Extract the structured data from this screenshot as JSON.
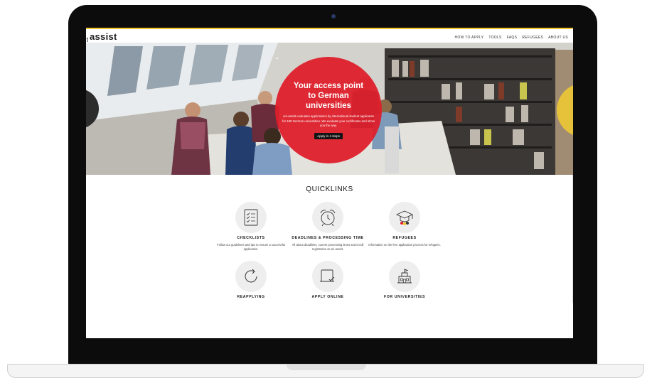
{
  "site": {
    "logo_small": "uni",
    "logo_main": "assist"
  },
  "nav": {
    "items": [
      "HOW TO APPLY",
      "TOOLS",
      "FAQS",
      "REFUGEES",
      "ABOUT US"
    ]
  },
  "hero": {
    "title": "Your access point to German universities",
    "subtitle": "uni-assist evaluates applications by international student applicants for 180 German universities. We evaluate your certificates and show you the way.",
    "button_label": "Apply in 4 steps",
    "button_icon": "arrow-right-icon"
  },
  "quicklinks": {
    "heading": "QUICKLINKS",
    "items": [
      {
        "label": "CHECKLISTS",
        "icon": "checklist-icon",
        "description": "Follow our guidelines and tips to ensure a successful application."
      },
      {
        "label": "DEADLINES & PROCESSING TIME",
        "icon": "alarm-clock-icon",
        "description": "All about deadlines, current processing times and enroll registration at uni-assist."
      },
      {
        "label": "REFUGEES",
        "icon": "graduation-cap-icon",
        "description": "Information on the free application process for refugees."
      },
      {
        "label": "REAPPLYING",
        "icon": "refresh-icon",
        "description": ""
      },
      {
        "label": "APPLY ONLINE",
        "icon": "tablet-check-icon",
        "description": ""
      },
      {
        "label": "FOR UNIVERSITIES",
        "icon": "university-building-icon",
        "description": ""
      }
    ]
  },
  "colors": {
    "accent_red": "#de1e2a",
    "accent_yellow": "#f3c52d",
    "frame": "#0c0c0c"
  }
}
